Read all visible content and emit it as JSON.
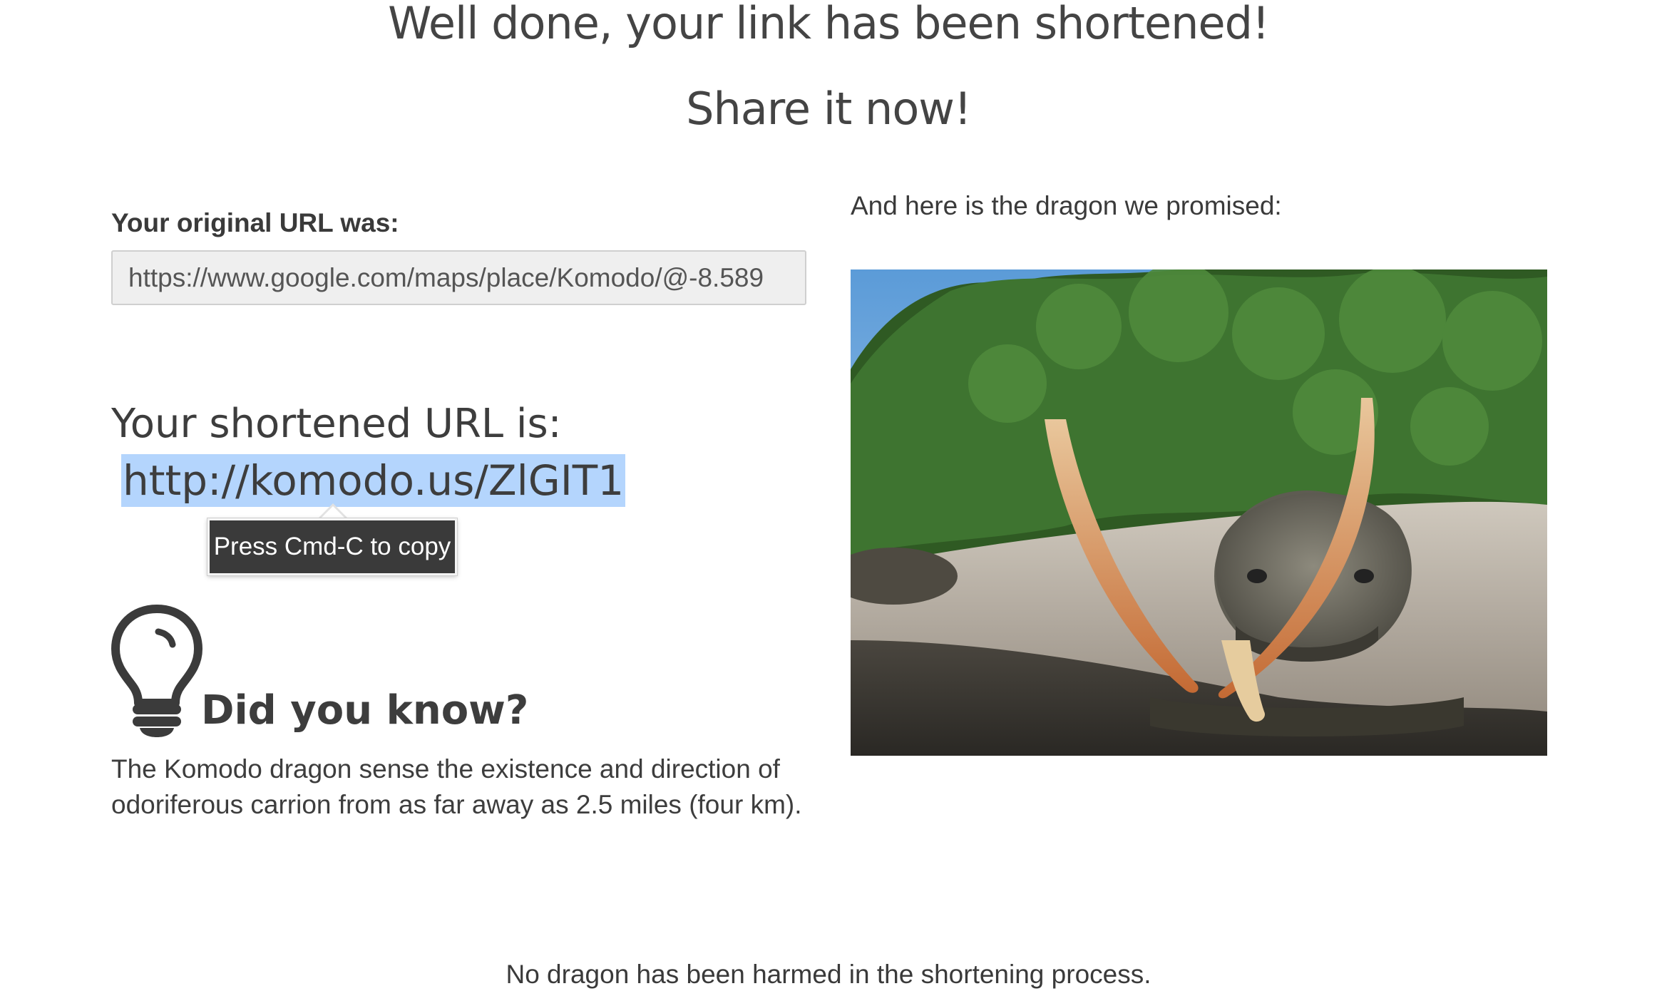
{
  "header": {
    "title": "Well done, your link has been shortened!",
    "subtitle": "Share it now!"
  },
  "original": {
    "label": "Your original URL was:",
    "value": "https://www.google.com/maps/place/Komodo/@-8.589"
  },
  "shortened": {
    "label": "Your shortened URL is:",
    "url": "http://komodo.us/ZlGIT1",
    "tooltip": "Press Cmd-C to copy"
  },
  "did_you_know": {
    "icon": "lightbulb-icon",
    "heading": "Did you know?",
    "text": "The Komodo dragon sense the existence and direction of odoriferous carrion from as far away as 2.5 miles (four km)."
  },
  "dragon": {
    "label": "And here is the dragon we promised:"
  },
  "footer": {
    "text": "No dragon has been harmed in the shortening process."
  },
  "colors": {
    "selection": "#b4d5fd",
    "tooltip_bg": "#3a3a3a",
    "text": "#3d3d3d"
  }
}
